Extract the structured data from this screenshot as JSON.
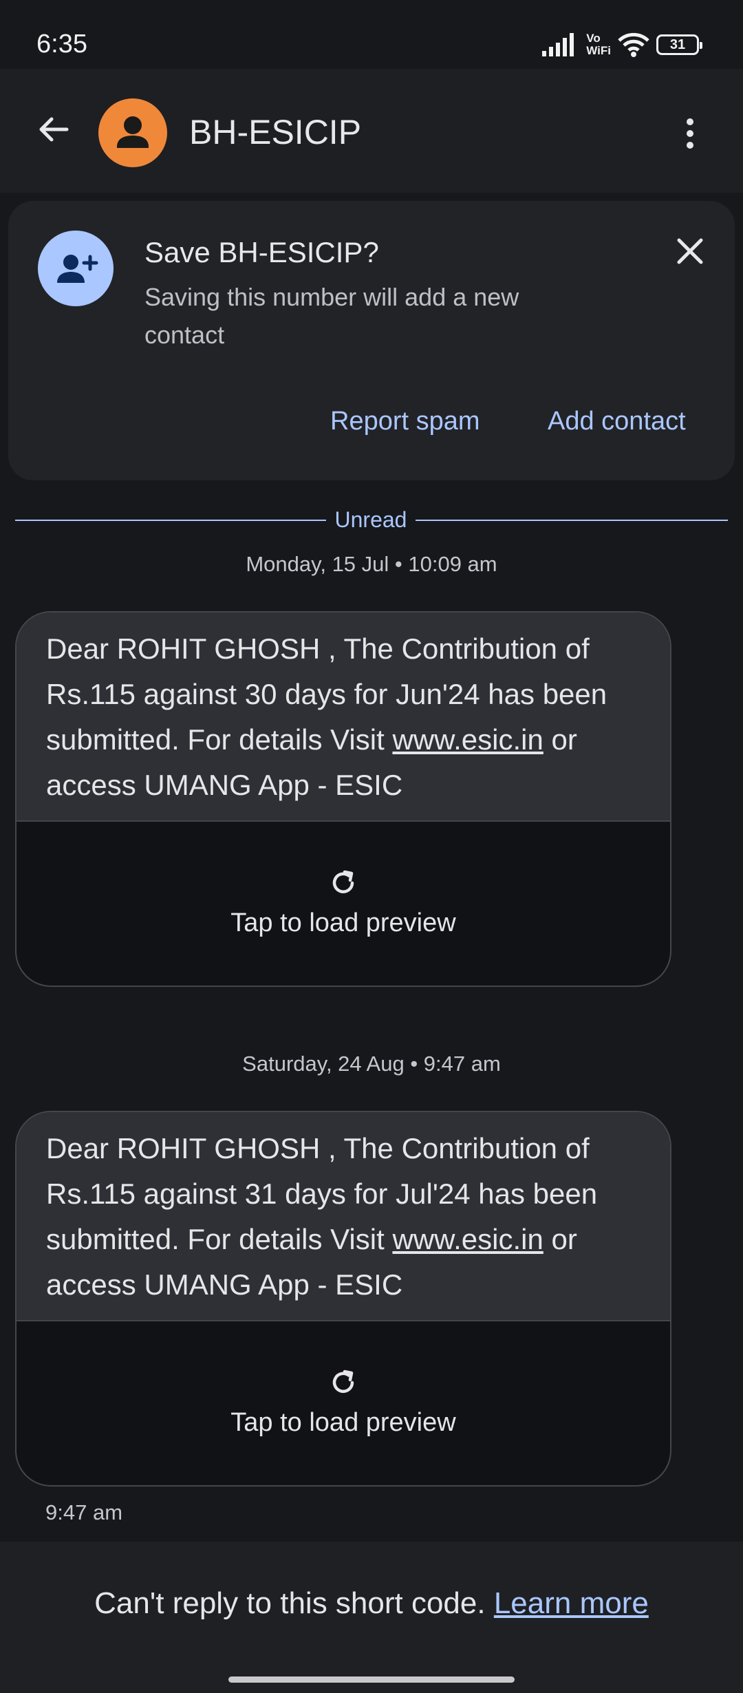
{
  "status_bar": {
    "time": "6:35",
    "vowifi_top": "Vo",
    "vowifi_bottom": "WiFi",
    "battery": "31"
  },
  "app_bar": {
    "title": "BH-ESICIP",
    "avatar_color": "#f0883a"
  },
  "save_card": {
    "title": "Save BH-ESICIP?",
    "description": "Saving this number will add a new contact",
    "report_spam": "Report spam",
    "add_contact": "Add contact"
  },
  "divider": {
    "label": "Unread"
  },
  "messages": [
    {
      "date": "Monday, 15 Jul • 10:09 am",
      "text_before_link": "Dear ROHIT GHOSH , The Contribution of Rs.115 against 30 days for Jun'24 has been submitted. For details Visit ",
      "link": "www.esic.in",
      "text_after_link": " or access UMANG App - ESIC",
      "preview_label": "Tap to load preview"
    },
    {
      "date": "Saturday, 24 Aug • 9:47 am",
      "text_before_link": "Dear ROHIT GHOSH , The Contribution of Rs.115 against 31 days for Jul'24 has been submitted. For details Visit ",
      "link": "www.esic.in",
      "text_after_link": " or access UMANG App - ESIC",
      "preview_label": "Tap to load preview",
      "time": "9:47 am"
    }
  ],
  "footer": {
    "text": "Can't reply to this short code. ",
    "learn_more": "Learn more"
  },
  "colors": {
    "accent": "#aac7ff",
    "background": "#17181c",
    "bubble": "#2f3035"
  },
  "icons": {
    "back": "arrow-left-icon",
    "avatar": "person-icon",
    "menu": "more-vert-icon",
    "add_contact": "person-add-icon",
    "close": "close-icon",
    "refresh": "refresh-icon",
    "signal": "signal-icon",
    "wifi": "wifi-icon",
    "battery": "battery-icon"
  }
}
